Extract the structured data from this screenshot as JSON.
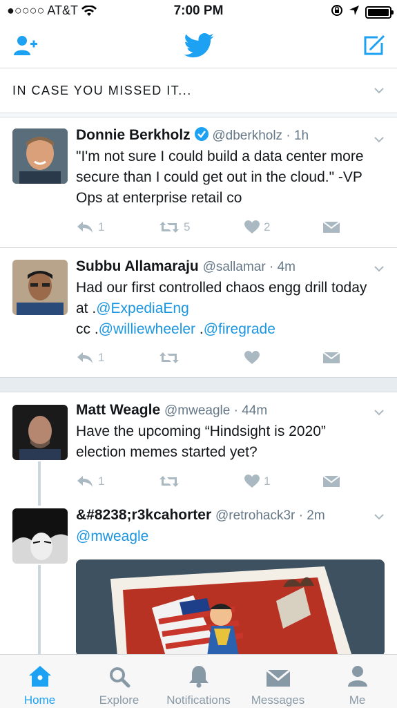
{
  "status_bar": {
    "carrier": "●○○○○ AT&T",
    "time": "7:00 PM"
  },
  "section": {
    "title": "IN CASE YOU MISSED IT..."
  },
  "tweets": [
    {
      "name": "Donnie Berkholz",
      "handle": "@dberkholz",
      "time": "1h",
      "text": "\"I'm not sure I could build a data center more secure than I could get out in the cloud.\" -VP Ops at enterprise retail co",
      "replies": "1",
      "retweets": "5",
      "likes": "2"
    },
    {
      "name": "Subbu Allamaraju",
      "handle": "@sallamar",
      "time": "4m",
      "text_a": "Had our first controlled chaos engg drill today at .",
      "link1": "@ExpediaEng",
      "text_b": "cc .",
      "link2": "@williewheeler",
      "text_c": " .",
      "link3": "@firegrade",
      "replies": "1",
      "retweets": "",
      "likes": ""
    },
    {
      "name": "Matt Weagle",
      "handle": "@mweagle",
      "time": "44m",
      "text": "Have the upcoming “Hindsight is 2020” election memes started yet?",
      "replies": "1",
      "retweets": "",
      "likes": "1"
    },
    {
      "name": "&#8238;r3kcahorter",
      "handle": "@retrohack3r",
      "time": "2m",
      "link1": "@mweagle"
    }
  ],
  "tabs": [
    {
      "label": "Home",
      "icon": "home-icon"
    },
    {
      "label": "Explore",
      "icon": "search-icon"
    },
    {
      "label": "Notifications",
      "icon": "bell-icon"
    },
    {
      "label": "Messages",
      "icon": "envelope-icon"
    },
    {
      "label": "Me",
      "icon": "person-icon"
    }
  ],
  "colors": {
    "accent": "#1da1f2",
    "link": "#1b95e0",
    "muted": "#aab8c2",
    "verified": "#1da1f2"
  }
}
